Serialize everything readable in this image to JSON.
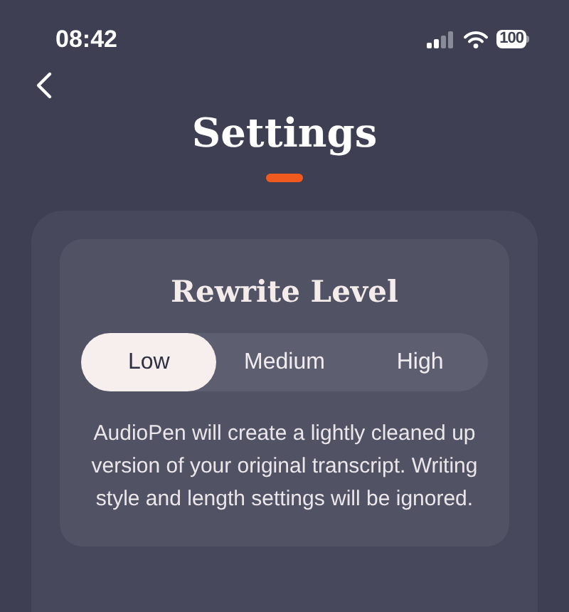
{
  "status_bar": {
    "time": "08:42",
    "battery": "100"
  },
  "header": {
    "title": "Settings"
  },
  "rewrite_level": {
    "title": "Rewrite Level",
    "options": [
      {
        "label": "Low",
        "selected": true
      },
      {
        "label": "Medium",
        "selected": false
      },
      {
        "label": "High",
        "selected": false
      }
    ],
    "description": "AudioPen will create a lightly cleaned up version of your original transcript. Writing style and length settings will be ignored."
  }
}
